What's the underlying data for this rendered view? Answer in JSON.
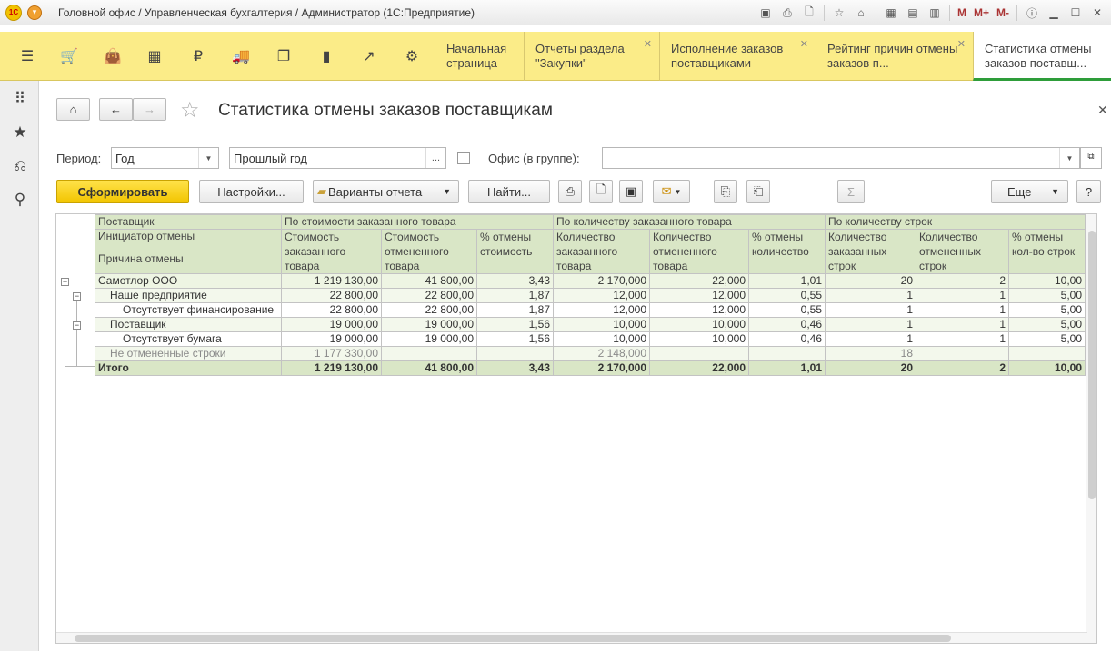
{
  "window": {
    "title": "Головной офис / Управленческая бухгалтерия / Администратор  (1С:Предприятие)",
    "logo_text": "1С",
    "menu_letters": [
      "M",
      "M+",
      "M-"
    ]
  },
  "tabs": [
    {
      "label": "Начальная страница",
      "closable": false,
      "active": false
    },
    {
      "label": "Отчеты раздела \"Закупки\"",
      "closable": true,
      "active": false
    },
    {
      "label": "Исполнение заказов поставщиками",
      "closable": true,
      "active": false
    },
    {
      "label": "Рейтинг причин отмены заказов п...",
      "closable": true,
      "active": false
    },
    {
      "label": "Статистика отмены заказов поставщ...",
      "closable": false,
      "active": true
    }
  ],
  "form": {
    "title": "Статистика отмены заказов поставщикам",
    "period_label": "Период:",
    "period_kind": "Год",
    "period_value": "Прошлый год",
    "period_more": "...",
    "office_label": "Офис (в группе):",
    "office_value": "",
    "generate_button": "Сформировать",
    "settings_button": "Настройки...",
    "variants_button": "Варианты отчета",
    "find_button": "Найти...",
    "more_button": "Еще",
    "help_button": "?",
    "sum_symbol": "Σ"
  },
  "report": {
    "header": {
      "col_supplier": "Поставщик",
      "col_initiator": "Инициатор отмены",
      "col_reason": "Причина отмены",
      "group_cost": "По стоимости заказанного товара",
      "group_qty": "По количеству заказанного товара",
      "group_lines": "По количеству строк",
      "cost_ordered": "Стоимость заказанного товара",
      "cost_cancelled": "Стоимость отмененного товара",
      "cost_pct": "% отмены стоимость",
      "qty_ordered": "Количество заказанного товара",
      "qty_cancelled": "Количество отмененного товара",
      "qty_pct": "% отмены количество",
      "lines_ordered": "Количество заказанных строк",
      "lines_cancelled": "Количество отмененных строк",
      "lines_pct": "% отмены кол-во строк"
    },
    "rows": [
      {
        "level": 0,
        "name": "Самотлор ООО",
        "v": [
          "1 219 130,00",
          "41 800,00",
          "3,43",
          "2 170,000",
          "22,000",
          "1,01",
          "20",
          "2",
          "10,00"
        ]
      },
      {
        "level": 1,
        "name": "Наше предприятие",
        "v": [
          "22 800,00",
          "22 800,00",
          "1,87",
          "12,000",
          "12,000",
          "0,55",
          "1",
          "1",
          "5,00"
        ]
      },
      {
        "level": 2,
        "name": "Отсутствует финансирование",
        "v": [
          "22 800,00",
          "22 800,00",
          "1,87",
          "12,000",
          "12,000",
          "0,55",
          "1",
          "1",
          "5,00"
        ]
      },
      {
        "level": 1,
        "name": "Поставщик",
        "v": [
          "19 000,00",
          "19 000,00",
          "1,56",
          "10,000",
          "10,000",
          "0,46",
          "1",
          "1",
          "5,00"
        ]
      },
      {
        "level": 2,
        "name": "Отсутствует бумага",
        "v": [
          "19 000,00",
          "19 000,00",
          "1,56",
          "10,000",
          "10,000",
          "0,46",
          "1",
          "1",
          "5,00"
        ]
      },
      {
        "level": 9,
        "name": "Не отмененные строки",
        "v": [
          "1 177 330,00",
          "",
          "",
          "2 148,000",
          "",
          "",
          "18",
          "",
          ""
        ]
      }
    ],
    "total": {
      "name": "Итого",
      "v": [
        "1 219 130,00",
        "41 800,00",
        "3,43",
        "2 170,000",
        "22,000",
        "1,01",
        "20",
        "2",
        "10,00"
      ]
    }
  }
}
